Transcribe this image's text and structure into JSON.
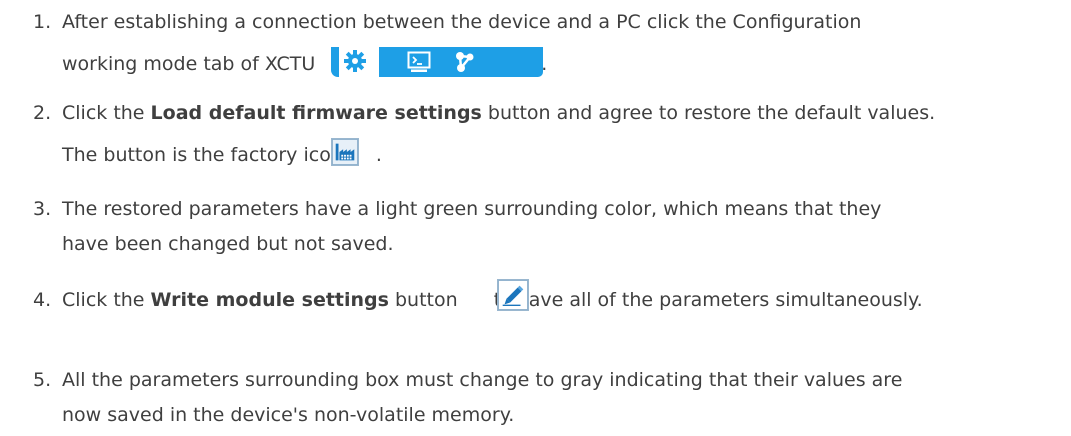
{
  "steps": [
    {
      "number": "1.",
      "line1": "After establishing a connection between the device and a PC click the Configuration",
      "line2": "working mode tab of XCTU",
      "line2_end": ".",
      "icons": [
        "configuration-gear-icon",
        "console-terminal-icon",
        "network-icon"
      ]
    },
    {
      "number": "2.",
      "line1_pre": "Click the ",
      "line1_bold": "Load default firmware settings",
      "line1_post": " button and agree to restore the default values.",
      "line2": "The button is the factory icon",
      "line2_end": ".",
      "icon": "factory-icon"
    },
    {
      "number": "3.",
      "line1": "The restored parameters have a light green surrounding color, which means that they",
      "line2": "have been changed but not saved."
    },
    {
      "number": "4.",
      "line1_pre": "Click the ",
      "line1_bold": "Write module settings",
      "line1_mid": " button ",
      "line1_post": "to save all of the parameters simultaneously.",
      "icon": "pencil-icon"
    },
    {
      "number": "5.",
      "line1": "All the parameters surrounding box must change to gray indicating that their values are",
      "line2": "now saved in the device's non-volatile memory."
    }
  ],
  "colors": {
    "text": "#3f3f3f",
    "xctu_blue": "#1e9fe6"
  }
}
